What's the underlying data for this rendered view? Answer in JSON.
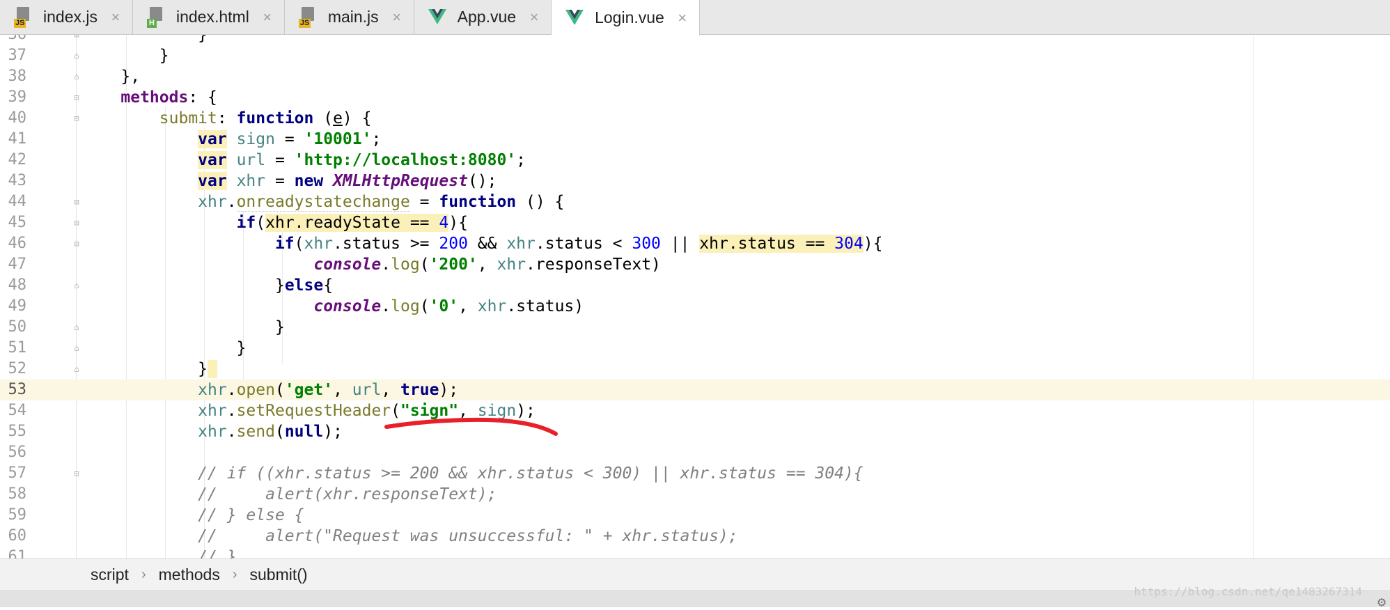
{
  "tabs": [
    {
      "name": "index.js",
      "type": "js"
    },
    {
      "name": "index.html",
      "type": "html"
    },
    {
      "name": "main.js",
      "type": "js"
    },
    {
      "name": "App.vue",
      "type": "vue"
    },
    {
      "name": "Login.vue",
      "type": "vue",
      "active": true
    }
  ],
  "icons": {
    "js_label": "JS",
    "html_label": "H",
    "close": "×",
    "vue_color": "#41b883",
    "vue_dark": "#35495e"
  },
  "editor": {
    "current_line": 53,
    "annotation_color": "#e8202a"
  },
  "code_text": {
    "l36": "}",
    "l37": "}",
    "l38": "},",
    "l39_methods": "methods",
    "l39_rest": ": {",
    "l40_submit": "submit",
    "l40_a": ": ",
    "l40_function": "function",
    "l40_b": " (",
    "l40_e": "e",
    "l40_c": ") {",
    "var": "var",
    "l41_name": "sign",
    "l41_eq": " = ",
    "l41_val": "'10001'",
    "l41_end": ";",
    "l42_name": "url",
    "l42_eq": " = ",
    "l42_val": "'http://localhost:8080'",
    "l42_end": ";",
    "l43_name": "xhr",
    "l43_eq": " = ",
    "l43_new": "new",
    "l43_cls": "XMLHttpRequest",
    "l43_end": "();",
    "xhr": "xhr",
    "dot": ".",
    "l44_prop": "onreadystatechange",
    "l44_eq": " = ",
    "l44_fn": "function",
    "l44_end": " () {",
    "if": "if",
    "l45_open": "(",
    "l45_hl": "xhr.readyState == ",
    "l45_num": "4",
    "l45_end": "){",
    "l46_a": "(",
    "l46_b": ".status >= ",
    "l46_n1": "200",
    "l46_c": " && ",
    "l46_d": ".status < ",
    "l46_n2": "300",
    "l46_e": " || ",
    "l46_hl": "xhr.status == ",
    "l46_n3": "304",
    "l46_end": "){",
    "console": "console",
    "log": "log",
    "l47_a": "(",
    "l47_str": "'200'",
    "l47_b": ", ",
    "l47_c": ".responseText)",
    "l48_a": "}",
    "l48_else": "else",
    "l48_b": "{",
    "l49_a": "(",
    "l49_str": "'0'",
    "l49_b": ", ",
    "l49_c": ".status)",
    "l50": "}",
    "l51": "}",
    "l52": "}",
    "l53_open": "open",
    "l53_a": "(",
    "l53_str": "'get'",
    "l53_b": ", ",
    "l53_url": "url",
    "l53_c": ", ",
    "l53_true": "true",
    "l53_end": ");",
    "l54_fn": "setRequestHeader",
    "l54_a": "(",
    "l54_str": "\"sign\"",
    "l54_b": ", ",
    "l54_sign": "sign",
    "l54_end": ");",
    "l55_fn": "send",
    "l55_a": "(",
    "l55_null": "null",
    "l55_end": ");",
    "l56": "",
    "l57": "// if ((xhr.status >= 200 && xhr.status < 300) || xhr.status == 304){",
    "l58": "//     alert(xhr.responseText);",
    "l59": "// } else {",
    "l60": "//     alert(\"Request was unsuccessful: \" + xhr.status);",
    "l61": "// }"
  },
  "breadcrumb": [
    "script",
    "methods",
    "submit()"
  ],
  "breadcrumb_sep": "›",
  "watermark": "https://blog.csdn.net/qe1483267314",
  "status_gear": "⚙"
}
